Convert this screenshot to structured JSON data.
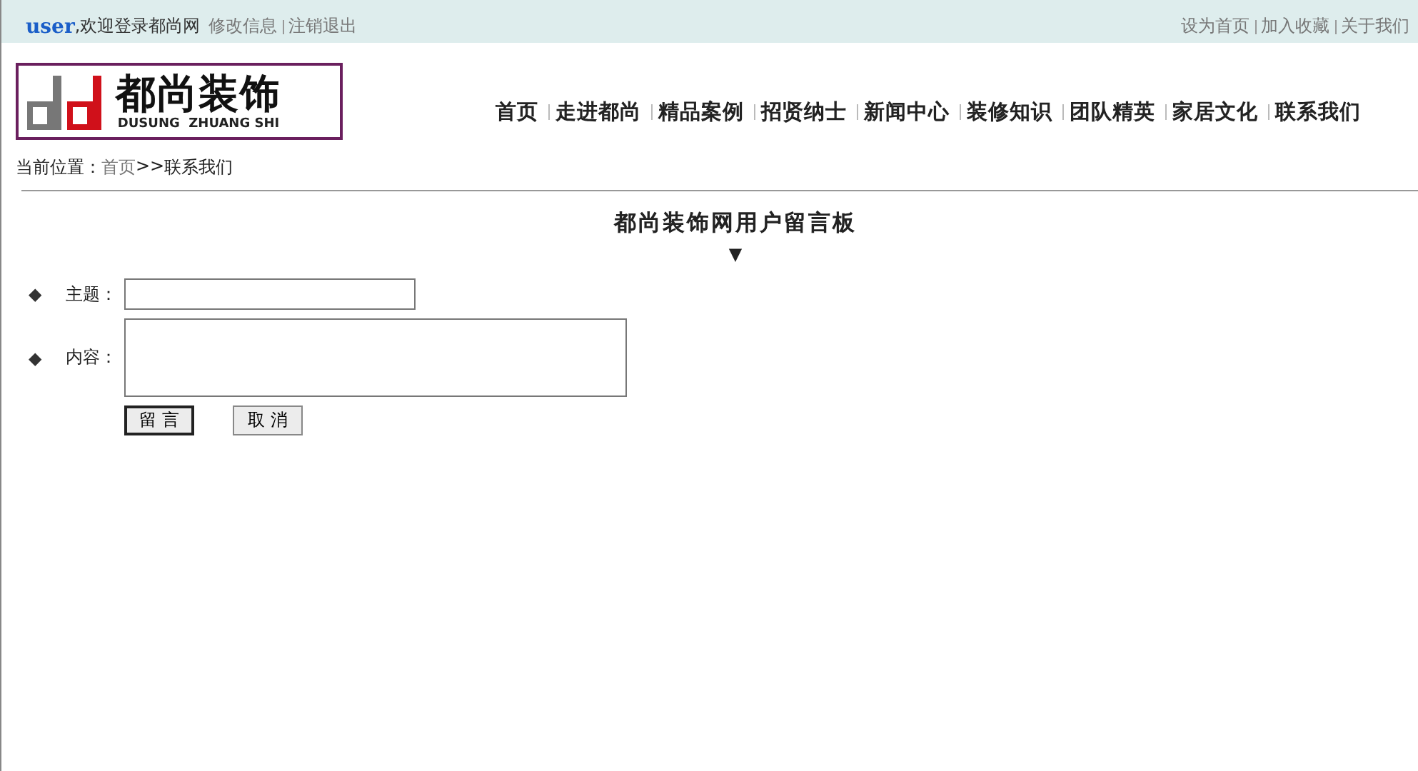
{
  "top_bar": {
    "user": "user",
    "welcome": ",欢迎登录都尚网",
    "links": [
      "修改信息",
      "注销退出"
    ],
    "right_links": [
      "设为首页",
      "加入收藏",
      "关于我们"
    ]
  },
  "logo": {
    "name": "都尚装饰",
    "subtitle": "DUSUNG  ZHUANG SHI"
  },
  "nav": [
    "首页",
    "走进都尚",
    "精品案例",
    "招贤纳士",
    "新闻中心",
    "装修知识",
    "团队精英",
    "家居文化",
    "联系我们"
  ],
  "breadcrumb": {
    "label": "当前位置：",
    "home": "首页",
    "separator": ">>",
    "current": "联系我们"
  },
  "board": {
    "title": "都尚装饰网用户留言板",
    "marker": "▼",
    "fields": [
      {
        "kind": "input",
        "bullet": "◆",
        "label": "主题："
      },
      {
        "kind": "textarea",
        "bullet": "◆",
        "label": "内容："
      }
    ],
    "buttons": [
      {
        "label": "留 言",
        "focused": true
      },
      {
        "label": "取 消",
        "focused": false
      }
    ]
  }
}
